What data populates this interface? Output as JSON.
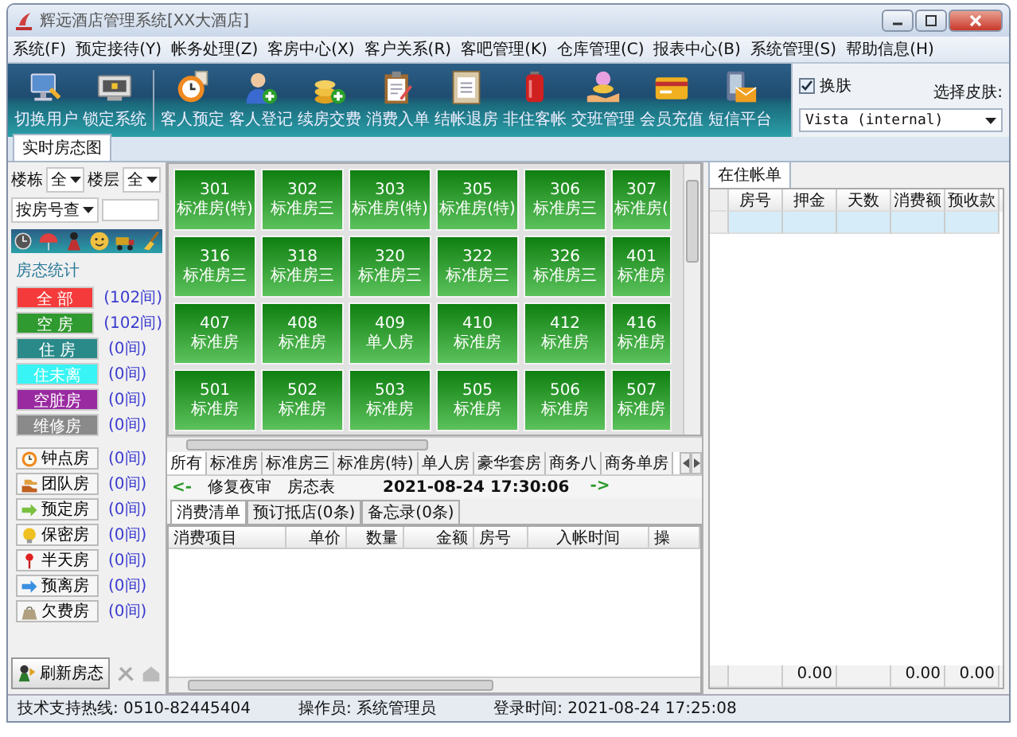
{
  "window": {
    "title": "辉远酒店管理系统[XX大酒店]"
  },
  "menu": [
    "系统(F)",
    "预定接待(Y)",
    "帐务处理(Z)",
    "客房中心(X)",
    "客户关系(R)",
    "客吧管理(K)",
    "仓库管理(C)",
    "报表中心(B)",
    "系统管理(S)",
    "帮助信息(H)"
  ],
  "toolbar": {
    "groups": [
      [
        "切换用户",
        "锁定系统"
      ],
      [
        "客人预定",
        "客人登记",
        "续房交费",
        "消费入单",
        "结帐退房",
        "非住客帐",
        "交班管理",
        "会员充值",
        "短信平台"
      ]
    ]
  },
  "skin": {
    "toggle": {
      "label": "换肤",
      "checked": true
    },
    "label": "选择皮肤:",
    "value": "Vista (internal)"
  },
  "main_tabs": [
    {
      "label": "实时房态图",
      "selected": true
    }
  ],
  "filters": {
    "building": {
      "label": "楼栋",
      "value": "全"
    },
    "floor": {
      "label": "楼层",
      "value": "全"
    },
    "search_mode": "按房号查"
  },
  "status_stats": {
    "title": "房态统计",
    "items": [
      {
        "label": "全 部",
        "count": "(102间)",
        "color": "#f43a3a"
      },
      {
        "label": "空 房",
        "count": "(102间)",
        "color": "#2f9a2f"
      },
      {
        "label": "住 房",
        "count": "(0间)",
        "color": "#2a8a8a"
      },
      {
        "label": "住未离",
        "count": "(0间)",
        "color": "#38f4f4"
      },
      {
        "label": "空脏房",
        "count": "(0间)",
        "color": "#9a2aa0"
      },
      {
        "label": "维修房",
        "count": "(0间)",
        "color": "#8a8a8a"
      }
    ]
  },
  "room_features": [
    {
      "label": "钟点房",
      "count": "(0间)"
    },
    {
      "label": "团队房",
      "count": "(0间)"
    },
    {
      "label": "预定房",
      "count": "(0间)"
    },
    {
      "label": "保密房",
      "count": "(0间)"
    },
    {
      "label": "半天房",
      "count": "(0间)"
    },
    {
      "label": "预离房",
      "count": "(0间)"
    },
    {
      "label": "欠费房",
      "count": "(0间)"
    }
  ],
  "refresh_button": "刷新房态",
  "rooms": [
    {
      "number": "301",
      "type": "标准房(特)"
    },
    {
      "number": "302",
      "type": "标准房三"
    },
    {
      "number": "303",
      "type": "标准房(特)"
    },
    {
      "number": "305",
      "type": "标准房(特)"
    },
    {
      "number": "306",
      "type": "标准房三"
    },
    {
      "number": "307",
      "type": "标准房("
    },
    {
      "number": "316",
      "type": "标准房三"
    },
    {
      "number": "318",
      "type": "标准房三"
    },
    {
      "number": "320",
      "type": "标准房三"
    },
    {
      "number": "322",
      "type": "标准房三"
    },
    {
      "number": "326",
      "type": "标准房三"
    },
    {
      "number": "401",
      "type": "标准房"
    },
    {
      "number": "407",
      "type": "标准房"
    },
    {
      "number": "408",
      "type": "标准房"
    },
    {
      "number": "409",
      "type": "单人房"
    },
    {
      "number": "410",
      "type": "标准房"
    },
    {
      "number": "412",
      "type": "标准房"
    },
    {
      "number": "416",
      "type": "标准房"
    },
    {
      "number": "501",
      "type": "标准房"
    },
    {
      "number": "502",
      "type": "标准房"
    },
    {
      "number": "503",
      "type": "标准房"
    },
    {
      "number": "505",
      "type": "标准房"
    },
    {
      "number": "506",
      "type": "标准房"
    },
    {
      "number": "507",
      "type": "标准房"
    }
  ],
  "room_categories": [
    {
      "label": "所有",
      "selected": true
    },
    {
      "label": "标准房",
      "selected": false
    },
    {
      "label": "标准房三",
      "selected": false
    },
    {
      "label": "标准房(特)",
      "selected": false
    },
    {
      "label": "单人房",
      "selected": false
    },
    {
      "label": "豪华套房",
      "selected": false
    },
    {
      "label": "商务八",
      "selected": false
    },
    {
      "label": "商务单房",
      "selected": false
    }
  ],
  "nav": {
    "back": "<-",
    "audit": "修复夜审",
    "room_table": "房态表",
    "datetime": "2021-08-24 17:30:06",
    "forward": "->"
  },
  "detail_tabs": [
    {
      "label": "消费清单",
      "selected": true
    },
    {
      "label": "预订抵店(0条)",
      "selected": false
    },
    {
      "label": "备忘录(0条)",
      "selected": false
    }
  ],
  "consumption_table": {
    "columns": [
      "消费项目",
      "单价",
      "数量",
      "金额",
      "房号",
      "入帐时间",
      "操"
    ]
  },
  "account_tabs": [
    {
      "label": "在住帐单",
      "selected": true
    }
  ],
  "account_table": {
    "columns": [
      "房号",
      "押金",
      "天数",
      "消费额",
      "预收款"
    ],
    "rows": [
      {
        "selected": true
      }
    ],
    "totals": {
      "deposit": "0.00",
      "spending": "0.00",
      "prepaid": "0.00"
    }
  },
  "status_bar": [
    "技术支持热线: 0510-82445404",
    "操作员: 系统管理员",
    "登录时间: 2021-08-24 17:25:08"
  ]
}
